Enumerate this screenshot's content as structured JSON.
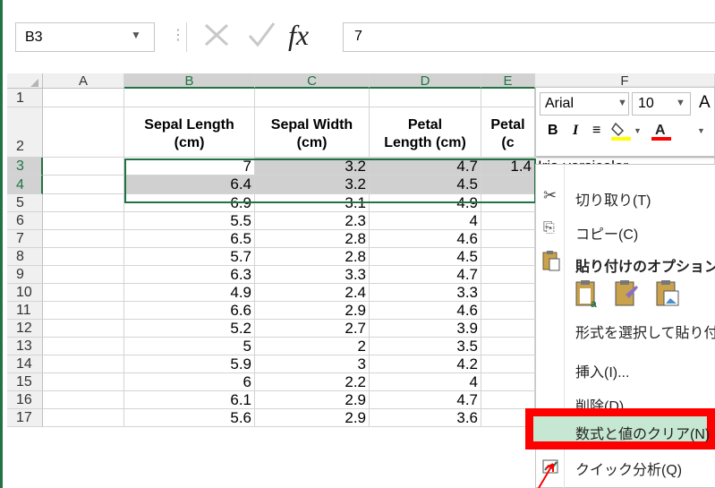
{
  "formula_bar": {
    "name_box": "B3",
    "formula": "7",
    "fx_label": "fx"
  },
  "columns": [
    "A",
    "B",
    "C",
    "D",
    "E",
    "F"
  ],
  "rows": [
    "1",
    "2",
    "3",
    "4",
    "5",
    "6",
    "7",
    "8",
    "9",
    "10",
    "11",
    "12",
    "13",
    "14",
    "15",
    "16",
    "17"
  ],
  "headers": {
    "b": [
      "Sepal Length",
      "(cm)"
    ],
    "c": [
      "Sepal Width",
      "(cm)"
    ],
    "d": [
      "Petal",
      "Length (cm)"
    ],
    "e": [
      "Petal",
      "(c"
    ]
  },
  "data": [
    [
      "7",
      "3.2",
      "4.7",
      "1.4"
    ],
    [
      "6.4",
      "3.2",
      "4.5",
      ""
    ],
    [
      "6.9",
      "3.1",
      "4.9",
      ""
    ],
    [
      "5.5",
      "2.3",
      "4",
      ""
    ],
    [
      "6.5",
      "2.8",
      "4.6",
      ""
    ],
    [
      "5.7",
      "2.8",
      "4.5",
      ""
    ],
    [
      "6.3",
      "3.3",
      "4.7",
      ""
    ],
    [
      "4.9",
      "2.4",
      "3.3",
      ""
    ],
    [
      "6.6",
      "2.9",
      "4.6",
      ""
    ],
    [
      "5.2",
      "2.7",
      "3.9",
      ""
    ],
    [
      "5",
      "2",
      "3.5",
      ""
    ],
    [
      "5.9",
      "3",
      "4.2",
      ""
    ],
    [
      "6",
      "2.2",
      "4",
      ""
    ],
    [
      "6.1",
      "2.9",
      "4.7",
      ""
    ],
    [
      "5.6",
      "2.9",
      "3.6",
      ""
    ]
  ],
  "f3_value": "Iris-versicolor",
  "mini_toolbar": {
    "font_name": "Arial",
    "font_size": "10",
    "grow_font": "A",
    "bold": "B",
    "italic": "I"
  },
  "context_menu": {
    "cut": "切り取り(T)",
    "copy": "コピー(C)",
    "paste_options": "貼り付けのオプション",
    "paste_special": "形式を選択して貼り付",
    "insert": "挿入(I)...",
    "delete": "削除(D)...",
    "clear_contents": "数式と値のクリア(N)",
    "quick_analysis": "クイック分析(Q)"
  },
  "colors": {
    "accent": "#217346",
    "highlight_box": "#ff0000",
    "hover": "#c6e7d1"
  }
}
